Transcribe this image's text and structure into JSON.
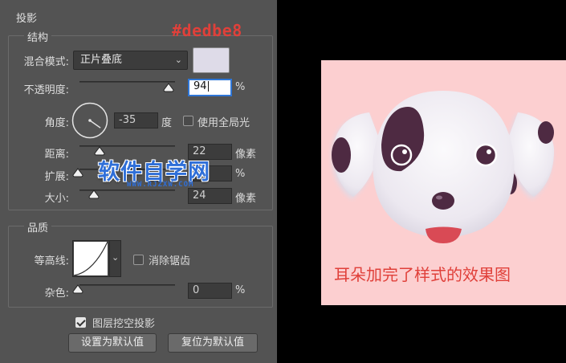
{
  "section": {
    "title": "投影"
  },
  "annotation": {
    "hex": "#dedbe8"
  },
  "structure": {
    "title": "结构",
    "blend_mode": {
      "label": "混合模式:",
      "value": "正片叠底",
      "swatch_color": "#dedbe8"
    },
    "opacity": {
      "label": "不透明度:",
      "value": "94",
      "unit": "%",
      "level_percent": 94
    },
    "angle": {
      "label": "角度:",
      "value": "-35",
      "unit": "度",
      "degrees": -35,
      "global_light_label": "使用全局光",
      "global_light_checked": false
    },
    "distance": {
      "label": "距离:",
      "value": "22",
      "unit": "像素"
    },
    "spread": {
      "label": "扩展:",
      "value": "0",
      "unit": "%"
    },
    "size": {
      "label": "大小:",
      "value": "24",
      "unit": "像素"
    }
  },
  "quality": {
    "title": "品质",
    "contour": {
      "label": "等高线:",
      "anti_alias_label": "消除锯齿",
      "anti_alias_checked": false
    },
    "noise": {
      "label": "杂色:",
      "value": "0",
      "unit": "%"
    }
  },
  "knockout": {
    "label": "图层挖空投影",
    "checked": true
  },
  "buttons": {
    "set_default": "设置为默认值",
    "reset_default": "复位为默认值"
  },
  "watermark": {
    "main": "软件自学网",
    "sub": "WWW.RJZXW.COM"
  },
  "preview": {
    "caption": "耳朵加完了样式的效果图",
    "background_color": "#fccfd0",
    "spot_color": "#4e2a42",
    "face_color": "#f4f1f6",
    "tongue_color": "#d94a55"
  }
}
